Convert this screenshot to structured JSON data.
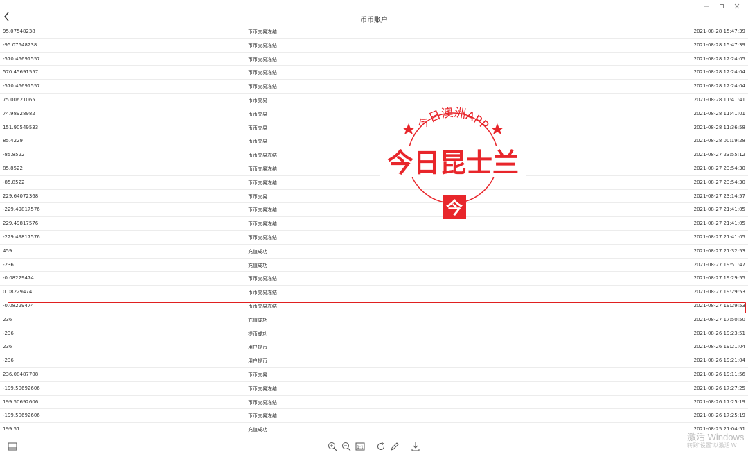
{
  "header": {
    "title": "币币账户"
  },
  "rows": [
    {
      "amount": "95.07548238",
      "type": "币币交易冻结",
      "time": "2021-08-28 15:47:39"
    },
    {
      "amount": "-95.07548238",
      "type": "币币交易冻结",
      "time": "2021-08-28 15:47:39"
    },
    {
      "amount": "-570.45691557",
      "type": "币币交易冻结",
      "time": "2021-08-28 12:24:05"
    },
    {
      "amount": "570.45691557",
      "type": "币币交易冻结",
      "time": "2021-08-28 12:24:04"
    },
    {
      "amount": "-570.45691557",
      "type": "币币交易冻结",
      "time": "2021-08-28 12:24:04"
    },
    {
      "amount": "75.00621065",
      "type": "币币交易",
      "time": "2021-08-28 11:41:41"
    },
    {
      "amount": "74.98928982",
      "type": "币币交易",
      "time": "2021-08-28 11:41:01"
    },
    {
      "amount": "151.90549533",
      "type": "币币交易",
      "time": "2021-08-28 11:36:58"
    },
    {
      "amount": "85.4229",
      "type": "币币交易",
      "time": "2021-08-28 00:19:28"
    },
    {
      "amount": "-85.8522",
      "type": "币币交易冻结",
      "time": "2021-08-27 23:55:12"
    },
    {
      "amount": "85.8522",
      "type": "币币交易冻结",
      "time": "2021-08-27 23:54:30"
    },
    {
      "amount": "-85.8522",
      "type": "币币交易冻结",
      "time": "2021-08-27 23:54:30"
    },
    {
      "amount": "229.64072368",
      "type": "币币交易",
      "time": "2021-08-27 23:14:57"
    },
    {
      "amount": "-229.49817576",
      "type": "币币交易冻结",
      "time": "2021-08-27 21:41:05"
    },
    {
      "amount": "229.49817576",
      "type": "币币交易冻结",
      "time": "2021-08-27 21:41:05"
    },
    {
      "amount": "-229.49817576",
      "type": "币币交易冻结",
      "time": "2021-08-27 21:41:05"
    },
    {
      "amount": "459",
      "type": "充值成功",
      "time": "2021-08-27 21:32:53"
    },
    {
      "amount": "-236",
      "type": "充值成功",
      "time": "2021-08-27 19:51:47"
    },
    {
      "amount": "-0.08229474",
      "type": "币币交易冻结",
      "time": "2021-08-27 19:29:55"
    },
    {
      "amount": "0.08229474",
      "type": "币币交易冻结",
      "time": "2021-08-27 19:29:53"
    },
    {
      "amount": "-0.08229474",
      "type": "币币交易冻结",
      "time": "2021-08-27 19:29:53"
    },
    {
      "amount": "236",
      "type": "充值成功",
      "time": "2021-08-27 17:50:50"
    },
    {
      "amount": "-236",
      "type": "提币成功",
      "time": "2021-08-26 19:23:51"
    },
    {
      "amount": "236",
      "type": "用户提币",
      "time": "2021-08-26 19:21:04"
    },
    {
      "amount": "-236",
      "type": "用户提币",
      "time": "2021-08-26 19:21:04"
    },
    {
      "amount": "236.08487708",
      "type": "币币交易",
      "time": "2021-08-26 19:11:56"
    },
    {
      "amount": "-199.50692606",
      "type": "币币交易冻结",
      "time": "2021-08-26 17:27:25"
    },
    {
      "amount": "199.50692606",
      "type": "币币交易冻结",
      "time": "2021-08-26 17:25:19"
    },
    {
      "amount": "-199.50692606",
      "type": "币币交易冻结",
      "time": "2021-08-26 17:25:19"
    },
    {
      "amount": "199.51",
      "type": "充值成功",
      "time": "2021-08-25 21:04:51"
    }
  ],
  "highlighted_row": 22,
  "seal": {
    "arc_text": "今日澳洲APP",
    "main_text": "今日昆士兰",
    "logo_char": "今",
    "color": "#e8262b"
  },
  "watermark": {
    "line1": "激活 Windows",
    "line2": "转到\"设置\"以激活 W"
  },
  "colors": {
    "highlight": "#e02020",
    "row_border": "#ececec"
  }
}
